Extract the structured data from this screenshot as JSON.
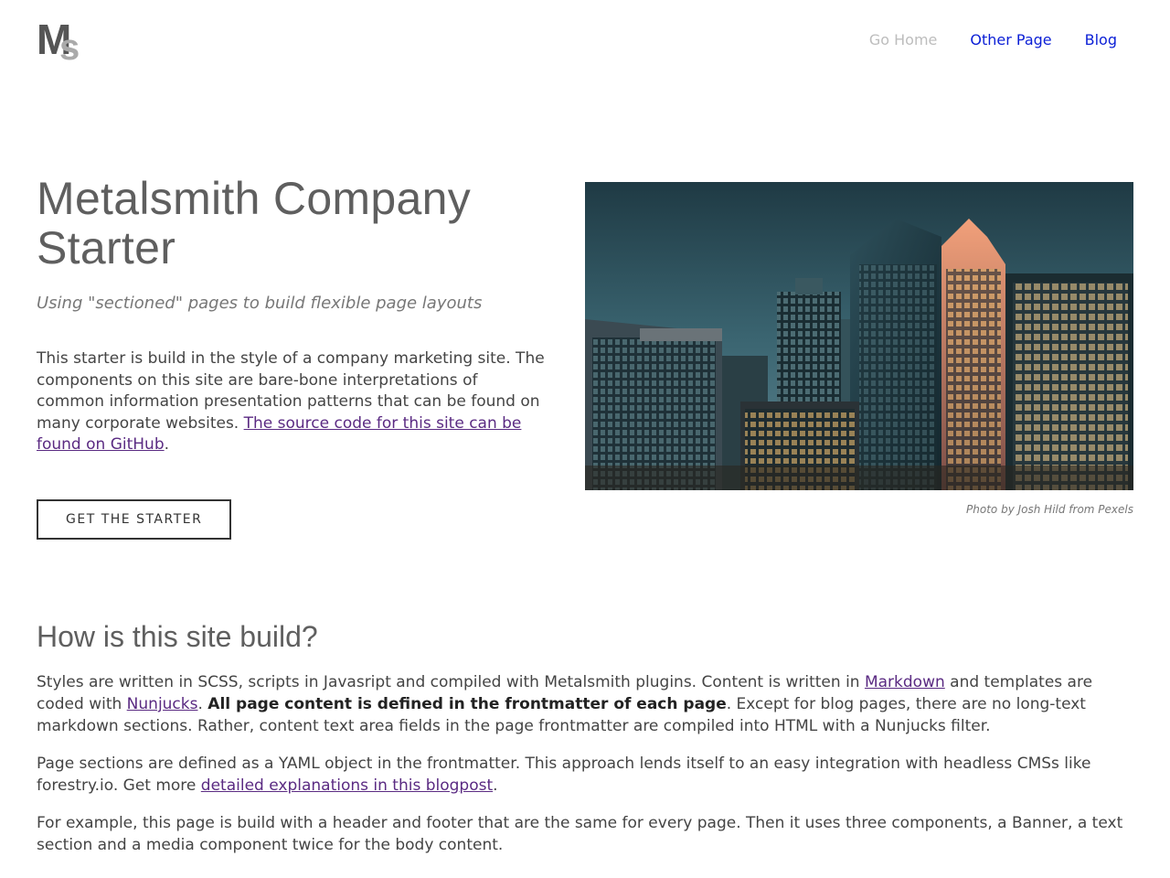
{
  "header": {
    "logo": {
      "primary": "M",
      "secondary": "s"
    },
    "nav": [
      {
        "label": "Go Home",
        "state": "current"
      },
      {
        "label": "Other Page",
        "state": "link"
      },
      {
        "label": "Blog",
        "state": "link"
      }
    ]
  },
  "banner": {
    "title": "Metalsmith Company Starter",
    "subtitle": "Using \"sectioned\" pages to build flexible page layouts",
    "intro_text": "This starter is build in the style of a company marketing site. The components on this site are bare-bone interpretations of common information presentation patterns that can be found on many corporate websites. ",
    "intro_link": "The source code for this site can be found on GitHub",
    "intro_end": ".",
    "cta_label": "GET THE STARTER",
    "photo_caption": "Photo by Josh Hild from Pexels"
  },
  "text_section": {
    "heading": "How is this site build?",
    "p1": {
      "a": "Styles are written in SCSS, scripts in Javasript and compiled with Metalsmith plugins. Content is written in ",
      "link1": "Markdown",
      "b": " and templates are coded with ",
      "link2": "Nunjucks",
      "c": ". ",
      "strong": "All page content is defined in the frontmatter of each page",
      "d": ". Except for blog pages, there are no long-text markdown sections. Rather, content text area fields in the page frontmatter are compiled into HTML with a Nunjucks filter."
    },
    "p2": {
      "a": "Page sections are defined as a YAML object in the frontmatter. This approach lends itself to an easy integration with headless CMSs like forestry.io. Get more ",
      "link": "detailed explanations in this blogpost",
      "b": "."
    },
    "p3": "For example, this page is build with a header and footer that are the same for every page. Then it uses three components, a Banner, a text section and a media component twice for the body content."
  }
}
